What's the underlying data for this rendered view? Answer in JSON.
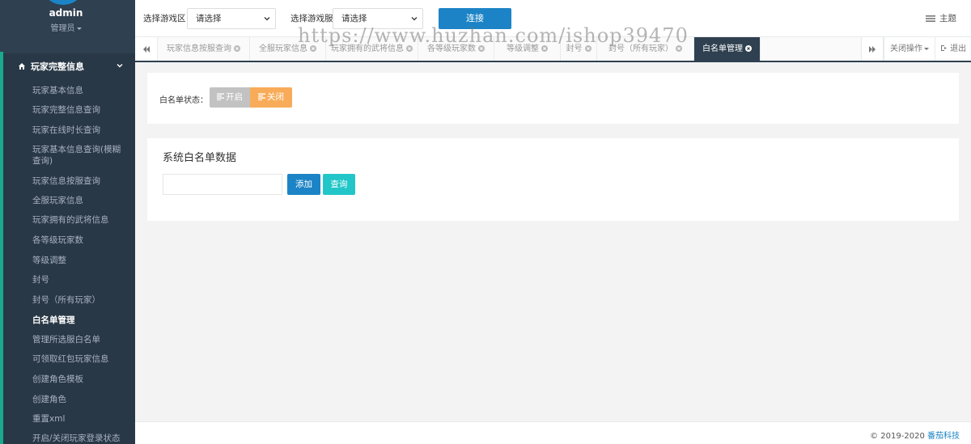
{
  "user": {
    "name": "admin",
    "role": "管理员"
  },
  "sidebar": {
    "header": "玩家完整信息",
    "items": [
      "玩家基本信息",
      "玩家完整信息查询",
      "玩家在线时长查询",
      "玩家基本信息查询(模糊查询)",
      "玩家信息按服查询",
      "全服玩家信息",
      "玩家拥有的武将信息",
      "各等级玩家数",
      "等级调整",
      "封号",
      "封号（所有玩家）",
      "白名单管理",
      "管理所选服白名单",
      "可领取红包玩家信息",
      "创建角色模板",
      "创建角色",
      "重置xml",
      "开启/关闭玩家登录状态"
    ],
    "active_index": 11
  },
  "topbar": {
    "zone_label": "选择游戏区",
    "zone_value": "请选择",
    "server_label": "选择游戏服",
    "server_value": "请选择",
    "connect_label": "连接",
    "theme_label": "主题"
  },
  "tabs": {
    "items": [
      "玩家信息按服查询",
      "全服玩家信息",
      "玩家拥有的武将信息",
      "各等级玩家数",
      "等级调整",
      "封号",
      "封号（所有玩家）",
      "白名单管理"
    ],
    "active_index": 7,
    "close_ops_label": "关闭操作",
    "logout_label": "退出"
  },
  "watermark": "https://www.huzhan.com/ishop39470",
  "whitelist_status": {
    "label": "白名单状态：",
    "on_label": "开启",
    "off_label": "关闭"
  },
  "whitelist_data": {
    "title": "系统白名单数据",
    "input_value": "",
    "add_label": "添加",
    "query_label": "查询"
  },
  "footer": {
    "copyright": "© 2019-2020 ",
    "brand": "番茄科技"
  },
  "colors": {
    "sidebar": "#2f4050",
    "primary": "#1c84c6",
    "warning": "#f8ac59",
    "info": "#23c6c8",
    "accent": "#19aa8d"
  }
}
